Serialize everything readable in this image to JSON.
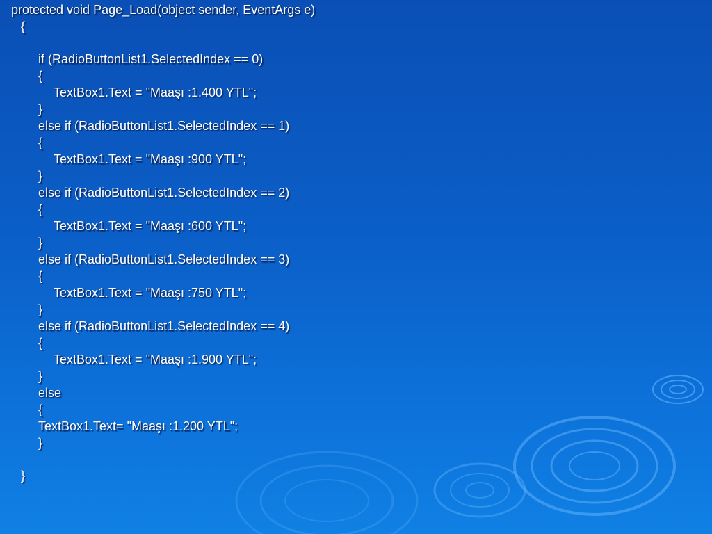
{
  "code_lines": [
    "protected void Page_Load(object sender, EventArgs e)",
    "{",
    "if (RadioButtonList1.SelectedIndex == 0)",
    "{",
    "TextBox1.Text = \"Maaşı :1.400 YTL\";",
    "}",
    "else if (RadioButtonList1.SelectedIndex == 1)",
    "{",
    "TextBox1.Text = \"Maaşı :900 YTL\";",
    "}",
    "else if (RadioButtonList1.SelectedIndex == 2)",
    "{",
    "TextBox1.Text = \"Maaşı :600 YTL\";",
    "}",
    "else if (RadioButtonList1.SelectedIndex == 3)",
    "{",
    "TextBox1.Text = \"Maaşı :750 YTL\";",
    "}",
    "else if (RadioButtonList1.SelectedIndex == 4)",
    "{",
    "TextBox1.Text = \"Maaşı :1.900 YTL\";",
    "}",
    "else",
    "{",
    "TextBox1.Text= \"Maaşı :1.200 YTL\";",
    "}",
    "}"
  ],
  "colors": {
    "background_top": "#0a4fb5",
    "background_bottom": "#1080e4",
    "text": "#ffffff",
    "ripple": "#5fb4ff"
  }
}
